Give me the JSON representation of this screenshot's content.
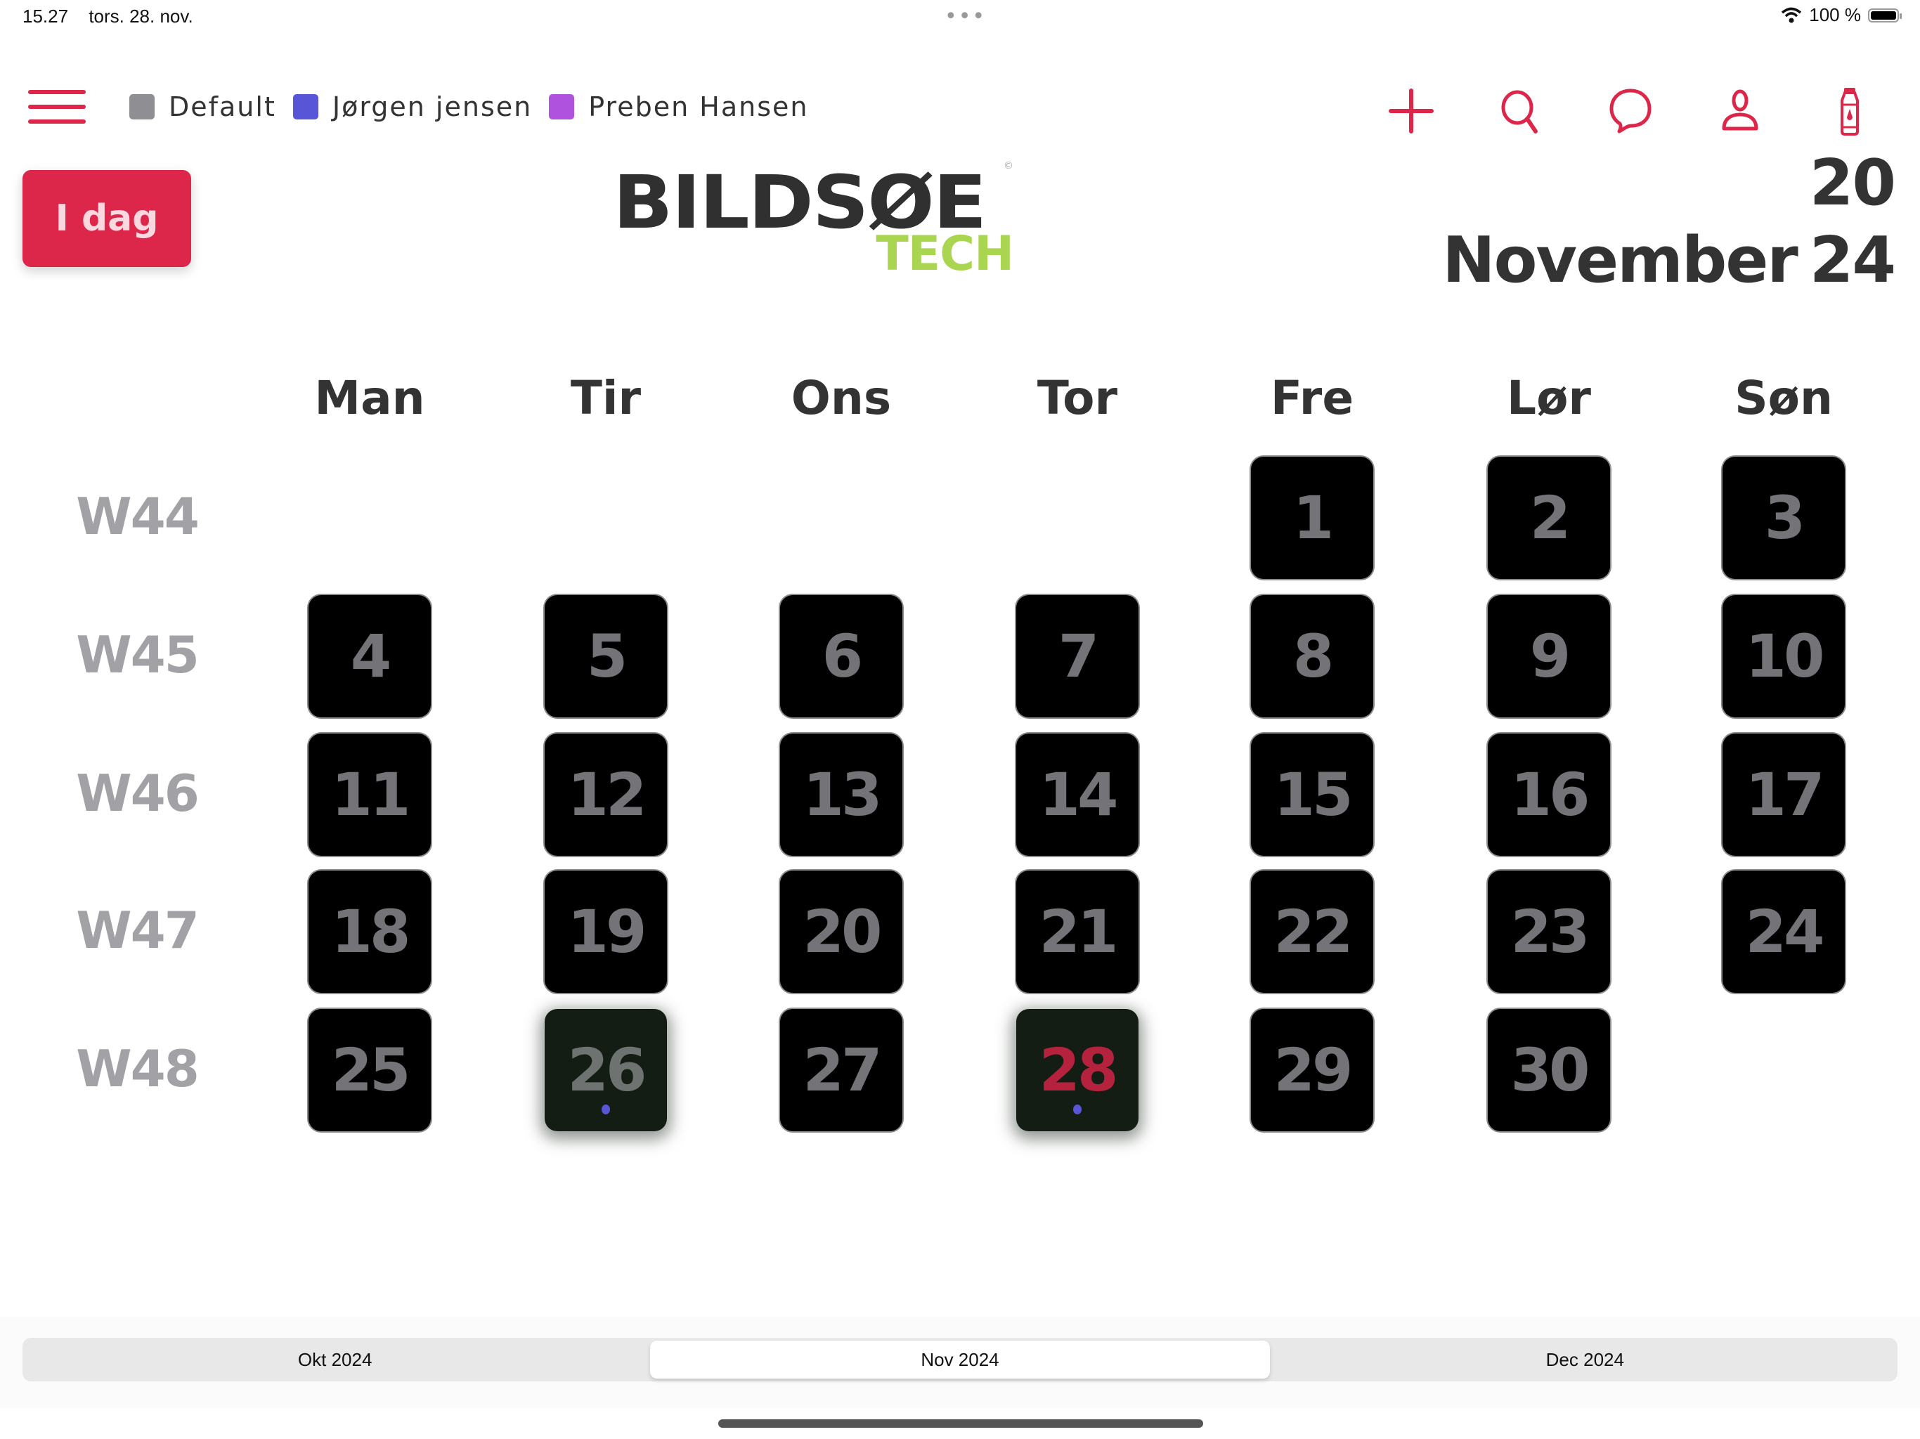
{
  "status_bar": {
    "time": "15.27",
    "date": "tors. 28. nov.",
    "battery_percent": "100 %",
    "battery_level": 1.0,
    "icons": [
      "wifi-icon",
      "battery-icon"
    ]
  },
  "legend": {
    "items": [
      {
        "label": "Default",
        "color": "#8e8e93"
      },
      {
        "label": "Jørgen jensen",
        "color": "#5856d6"
      },
      {
        "label": "Preben Hansen",
        "color": "#af52de"
      }
    ]
  },
  "toolbar": {
    "accent": "#dc264a",
    "icons": [
      "add-icon",
      "search-icon",
      "chat-icon",
      "profile-icon",
      "bottle-icon"
    ]
  },
  "today_button": {
    "label": "I dag"
  },
  "logo": {
    "main": "BILDSØE",
    "sub": "TECH"
  },
  "header": {
    "year_top": "20",
    "month": "November",
    "year_bottom": "24"
  },
  "calendar": {
    "day_headers": [
      "Man",
      "Tir",
      "Ons",
      "Tor",
      "Fre",
      "Lør",
      "Søn"
    ],
    "weeks": [
      {
        "label": "W44",
        "days": [
          null,
          null,
          null,
          null,
          1,
          2,
          3
        ]
      },
      {
        "label": "W45",
        "days": [
          4,
          5,
          6,
          7,
          8,
          9,
          10
        ]
      },
      {
        "label": "W46",
        "days": [
          11,
          12,
          13,
          14,
          15,
          16,
          17
        ]
      },
      {
        "label": "W47",
        "days": [
          18,
          19,
          20,
          21,
          22,
          23,
          24
        ]
      },
      {
        "label": "W48",
        "days": [
          25,
          26,
          27,
          28,
          29,
          30,
          null
        ]
      }
    ],
    "event_days": [
      26,
      28
    ],
    "event_dot_color": "#5856d6",
    "today": 28,
    "today_color": "#b4223d"
  },
  "month_switcher": {
    "options": [
      "Okt 2024",
      "Nov 2024",
      "Dec 2024"
    ],
    "selected": "Nov 2024"
  }
}
